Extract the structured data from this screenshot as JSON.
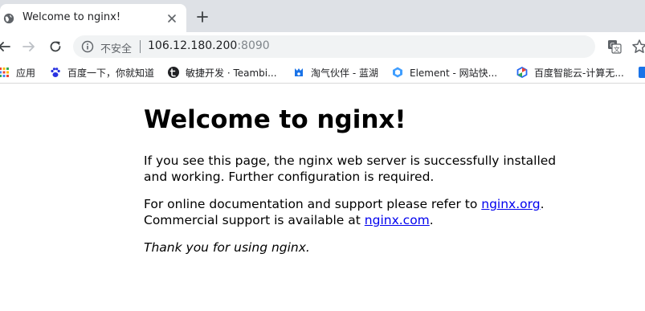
{
  "browser": {
    "tab": {
      "title": "Welcome to nginx!",
      "favicon": "globe-icon"
    },
    "new_tab_icon": "plus-icon",
    "toolbar": {
      "back_icon": "arrow-left-icon",
      "forward_icon": "arrow-right-icon",
      "reload_icon": "reload-icon",
      "security_icon": "info-icon",
      "security_text": "不安全",
      "url_host": "106.12.180.200",
      "url_port": ":8090",
      "translate_icon": "translate-icon",
      "bookmark_icon": "star-icon"
    },
    "bookmarks": [
      {
        "label": "应用",
        "icon": "apps-grid-icon"
      },
      {
        "label": "百度一下，你就知道",
        "icon": "baidu-paw-icon"
      },
      {
        "label": "敏捷开发 · Teambi...",
        "icon": "teambition-icon"
      },
      {
        "label": "淘气伙伴 - 蓝湖",
        "icon": "lanhu-icon"
      },
      {
        "label": "Element - 网站快...",
        "icon": "element-icon"
      },
      {
        "label": "百度智能云-计算无...",
        "icon": "baidu-cloud-icon"
      }
    ]
  },
  "page": {
    "heading": "Welcome to nginx!",
    "para1": "If you see this page, the nginx web server is successfully installed and working. Further configuration is required.",
    "para2_prefix": "For online documentation and support please refer to ",
    "link1": "nginx.org",
    "para2_mid": ".",
    "para2_line2_prefix": "Commercial support is available at ",
    "link2": "nginx.com",
    "para2_suffix": ".",
    "thanks": "Thank you for using nginx."
  },
  "colors": {
    "tabstrip_bg": "#dee1e6",
    "omnibox_bg": "#f1f3f4",
    "link": "#0000ee"
  }
}
